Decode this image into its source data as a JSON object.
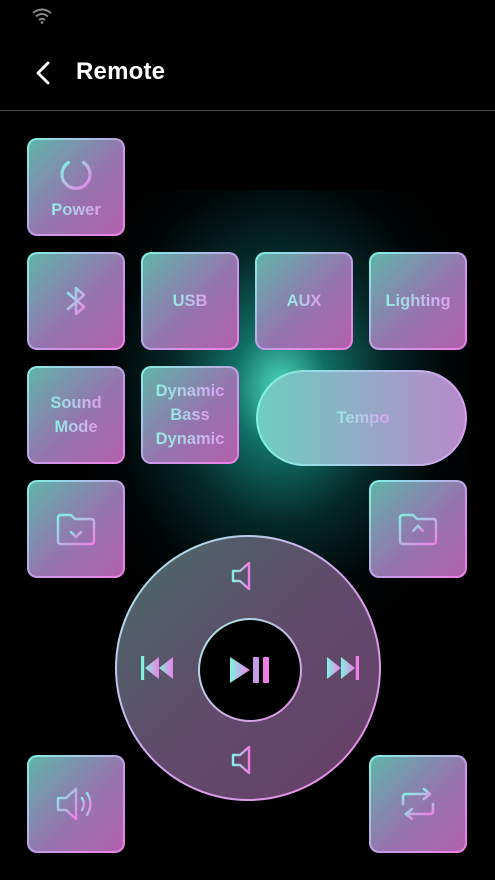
{
  "header": {
    "title": "Remote"
  },
  "buttons": {
    "power": "Power",
    "usb": "USB",
    "aux": "AUX",
    "lighting": "Lighting",
    "sound_mode": [
      "Sound",
      "Mode"
    ],
    "dynamic_bass": [
      "Dynamic",
      "Bass",
      "Dynamic"
    ],
    "tempo": "Tempo"
  },
  "icons": {
    "status": "wifi-icon",
    "back": "chevron-left-icon",
    "power": "power-icon",
    "bluetooth": "bluetooth-icon",
    "folder_down": "folder-download-icon",
    "folder_up": "folder-upload-icon",
    "volume_up": "volume-plus-icon",
    "volume_down": "volume-minus-icon",
    "previous": "skip-previous-icon",
    "next": "skip-next-icon",
    "play_pause": "play-pause-icon",
    "speaker": "speaker-volume-icon",
    "repeat": "repeat-icon"
  },
  "colors": {
    "background": "#000000",
    "accent_cyan": "#7ff2e3",
    "accent_pink": "#ef7fe6",
    "glow": "#40e6cc"
  }
}
